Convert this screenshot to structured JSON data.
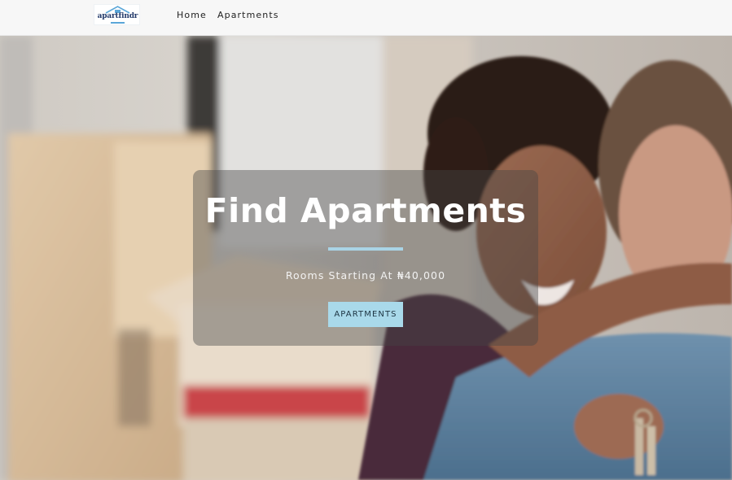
{
  "brand": {
    "logo_text": "apartfindr",
    "logo_icon": "house-roof-icon"
  },
  "nav": {
    "items": [
      {
        "label": "Home"
      },
      {
        "label": "Apartments"
      }
    ]
  },
  "hero": {
    "title": "Find Apartments",
    "subtitle": "Rooms Starting At ₦40,000",
    "button_label": "APARTMENTS",
    "background_image": "couple-hugging-with-house-keys-moving-boxes-photo"
  },
  "colors": {
    "navbar_bg": "#f7f7f7",
    "accent": "#a9d4e6",
    "button_bg": "#a9d9ea",
    "overlay": "rgba(70,70,70,0.42)",
    "logo_text": "#243b6b"
  }
}
